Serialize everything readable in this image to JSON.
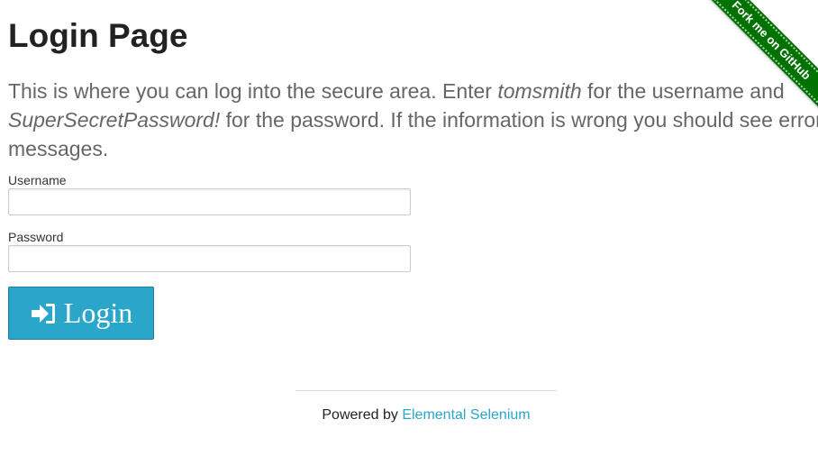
{
  "page": {
    "title": "Login Page",
    "intro": {
      "text_1": "This is where you can log into the secure area. Enter ",
      "username_hint": "tomsmith",
      "text_2": " for the username and ",
      "password_hint": "SuperSecretPassword!",
      "text_3": " for the password. If the information is wrong you should see error messages."
    }
  },
  "form": {
    "username_label": "Username",
    "username_value": "",
    "username_placeholder": "",
    "password_label": "Password",
    "password_value": "",
    "password_placeholder": "",
    "login_button_label": "Login",
    "login_icon": "sign-in-icon"
  },
  "footer": {
    "powered_by": "Powered by ",
    "link_text": "Elemental Selenium"
  },
  "ribbon": {
    "text": "Fork me on GitHub",
    "color": "#007200"
  },
  "colors": {
    "accent": "#2ba6cb",
    "title": "#222222",
    "body_text": "#666666"
  }
}
